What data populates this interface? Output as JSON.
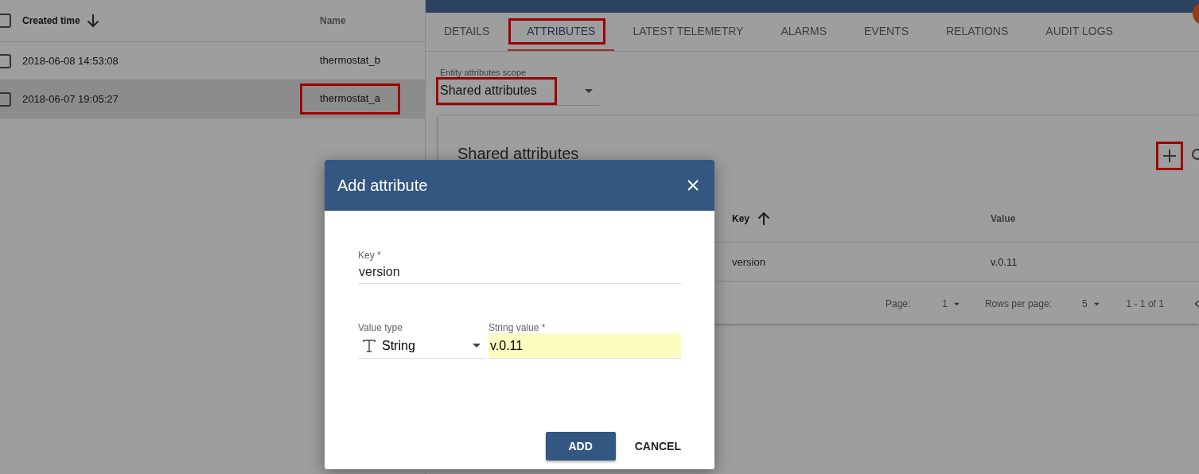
{
  "entity_table": {
    "header_checked": false,
    "columns": [
      {
        "label": "Created time",
        "sorted": true,
        "descending": true
      },
      {
        "label": "Name",
        "sorted": false
      }
    ],
    "rows": [
      {
        "created_time": "2018-06-08 14:53:08",
        "name": "thermostat_b",
        "selected": false,
        "checked": false,
        "highlighted": false
      },
      {
        "created_time": "2018-06-07 19:05:27",
        "name": "thermostat_a",
        "selected": true,
        "checked": false,
        "highlighted": true
      }
    ]
  },
  "tabs": [
    {
      "label": "DETAILS",
      "selected": false,
      "highlighted": false
    },
    {
      "label": "ATTRIBUTES",
      "selected": true,
      "highlighted": true
    },
    {
      "label": "LATEST TELEMETRY",
      "selected": false,
      "highlighted": false
    },
    {
      "label": "ALARMS",
      "selected": false,
      "highlighted": false
    },
    {
      "label": "EVENTS",
      "selected": false,
      "highlighted": false
    },
    {
      "label": "RELATIONS",
      "selected": false,
      "highlighted": false
    },
    {
      "label": "AUDIT LOGS",
      "selected": false,
      "highlighted": false
    }
  ],
  "scope": {
    "label": "Entity attributes scope",
    "value": "Shared attributes",
    "highlighted": true
  },
  "attributes_card": {
    "title": "Shared attributes",
    "add_highlighted": true,
    "columns": [
      {
        "label": "Key",
        "sorted": true,
        "descending": false
      },
      {
        "label": "Value",
        "sorted": false
      }
    ],
    "rows": [
      {
        "key": "version",
        "value": "v.0.11"
      }
    ],
    "footer": {
      "page_label": "Page:",
      "page": "1",
      "rows_label": "Rows per page:",
      "rows_per_page": "5",
      "range": "1 - 1 of 1"
    }
  },
  "dialog": {
    "title": "Add attribute",
    "key": {
      "label": "Key *",
      "value": "version"
    },
    "value_type": {
      "label": "Value type",
      "value": "String"
    },
    "string_value": {
      "label": "String value *",
      "value": "v.0.11"
    },
    "buttons": [
      {
        "label": "ADD",
        "kind": "primary"
      },
      {
        "label": "CANCEL",
        "kind": "flat"
      }
    ]
  }
}
